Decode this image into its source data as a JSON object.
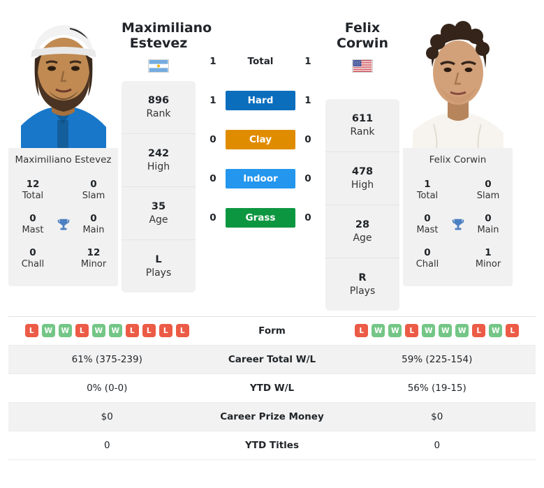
{
  "left_player": {
    "name": "Maximiliano Estevez",
    "name_line1": "Maximiliano",
    "name_line2": "Estevez",
    "photo_name": "Maximiliano Estevez",
    "country": "Argentina",
    "flag_icon": "flag-argentina-icon",
    "titles": {
      "total_value": "12",
      "total_label": "Total",
      "slam_value": "0",
      "slam_label": "Slam",
      "mast_value": "0",
      "mast_label": "Mast",
      "main_value": "0",
      "main_label": "Main",
      "chall_value": "0",
      "chall_label": "Chall",
      "minor_value": "12",
      "minor_label": "Minor"
    },
    "stats": [
      {
        "value": "896",
        "label": "Rank"
      },
      {
        "value": "242",
        "label": "High"
      },
      {
        "value": "35",
        "label": "Age"
      },
      {
        "value": "L",
        "label": "Plays"
      }
    ],
    "surface_wins": {
      "total": "1",
      "hard": "1",
      "clay": "0",
      "indoor": "0",
      "grass": "0"
    },
    "form": [
      "L",
      "W",
      "W",
      "L",
      "W",
      "W",
      "L",
      "L",
      "L",
      "L"
    ],
    "career_total_wl": "61% (375-239)",
    "ytd_wl": "0% (0-0)",
    "career_prize_money": "$0",
    "ytd_titles": "0"
  },
  "right_player": {
    "name": "Felix Corwin",
    "name_line1": "Felix Corwin",
    "name_line2": "",
    "photo_name": "Felix Corwin",
    "country": "United States",
    "flag_icon": "flag-usa-icon",
    "titles": {
      "total_value": "1",
      "total_label": "Total",
      "slam_value": "0",
      "slam_label": "Slam",
      "mast_value": "0",
      "mast_label": "Mast",
      "main_value": "0",
      "main_label": "Main",
      "chall_value": "0",
      "chall_label": "Chall",
      "minor_value": "1",
      "minor_label": "Minor"
    },
    "stats": [
      {
        "value": "611",
        "label": "Rank"
      },
      {
        "value": "478",
        "label": "High"
      },
      {
        "value": "28",
        "label": "Age"
      },
      {
        "value": "R",
        "label": "Plays"
      }
    ],
    "surface_wins": {
      "total": "1",
      "hard": "1",
      "clay": "0",
      "indoor": "0",
      "grass": "0"
    },
    "form": [
      "L",
      "W",
      "W",
      "L",
      "W",
      "W",
      "W",
      "L",
      "W",
      "L"
    ],
    "career_total_wl": "59% (225-154)",
    "ytd_wl": "56% (19-15)",
    "career_prize_money": "$0",
    "ytd_titles": "0"
  },
  "surfaces": [
    {
      "key": "total",
      "label": "Total",
      "color": "transparent",
      "plain": true
    },
    {
      "key": "hard",
      "label": "Hard",
      "color": "#0b6ebd",
      "plain": false
    },
    {
      "key": "clay",
      "label": "Clay",
      "color": "#e08c00",
      "plain": false
    },
    {
      "key": "indoor",
      "label": "Indoor",
      "color": "#2496ed",
      "plain": false
    },
    {
      "key": "grass",
      "label": "Grass",
      "color": "#0d9640",
      "plain": false
    }
  ],
  "table_labels": {
    "form": "Form",
    "career_total_wl": "Career Total W/L",
    "ytd_wl": "YTD W/L",
    "career_prize_money": "Career Prize Money",
    "ytd_titles": "YTD Titles"
  },
  "colors": {
    "win_badge": "#74c686",
    "loss_badge": "#ec5b46",
    "hard": "#0b6ebd",
    "clay": "#e08c00",
    "indoor": "#2496ed",
    "grass": "#0d9640",
    "trophy": "#4a7fc1",
    "card_bg": "#f1f1f1",
    "row_alt_bg": "#f2f2f2"
  }
}
